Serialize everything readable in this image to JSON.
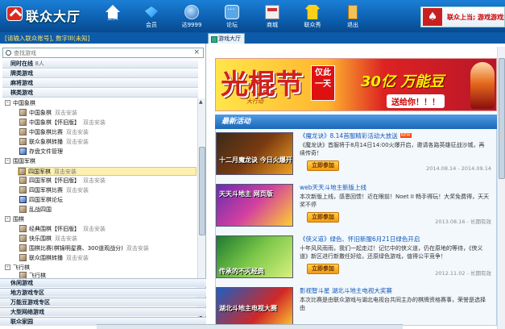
{
  "app": {
    "logo_text": "联众大厅"
  },
  "nav": [
    {
      "label": "主页",
      "icon": "home-icon"
    },
    {
      "label": "会员",
      "icon": "diamond-icon"
    },
    {
      "label": "达9999",
      "icon": "globe-icon"
    },
    {
      "label": "论坛",
      "icon": "chat-icon"
    },
    {
      "label": "商城",
      "icon": "shop-icon"
    },
    {
      "label": "联众秀",
      "icon": "shirt-icon"
    },
    {
      "label": "退出",
      "icon": "door-icon"
    }
  ],
  "notice": {
    "text": "联众上当; 游戏游戏益贼; 游"
  },
  "account": {
    "text": "[请输入联众账号], 数字III(未知]"
  },
  "tabs": {
    "hall": "游戏大厅"
  },
  "search": {
    "placeholder": "查找游戏"
  },
  "categories": {
    "online": {
      "label": "同时在线",
      "count": "8人"
    },
    "poker": "牌类游戏",
    "mahjong": "麻将游戏",
    "chess": "棋类游戏",
    "casual": "休闲游戏",
    "local": "地方游戏专区",
    "wanneng": "万能豆游戏专区",
    "network": "大型网络游戏",
    "home": "联众家园"
  },
  "tree": {
    "xiangqi": "中国象棋",
    "go": "围国军棋",
    "wuziqi": "围棋",
    "flying": "飞行棋",
    "action": "双击安装",
    "items": [
      {
        "label": "中国象棋"
      },
      {
        "label": "中国象棋【怀旧版】"
      },
      {
        "label": "中国象棋比赛"
      },
      {
        "label": "联众象棋转播"
      },
      {
        "label": "存盘文件管理"
      },
      {
        "label": "四国军棋"
      },
      {
        "label": "四国军棋【怀旧版】"
      },
      {
        "label": "四国军棋比赛"
      },
      {
        "label": "四国军棋论坛"
      },
      {
        "label": "乱战四国"
      },
      {
        "label": "经典围棋【怀旧版】"
      },
      {
        "label": "快乐围棋"
      },
      {
        "label": "围棋比赛(棋锦明星赛、300道观战分)"
      },
      {
        "label": "联众围棋转播"
      },
      {
        "label": "飞行棋"
      }
    ]
  },
  "banner": {
    "big": "光棍节",
    "small": "大行动",
    "tag": "仅此一天",
    "yi": "30亿 万能豆",
    "send": "送给你！！！"
  },
  "news": {
    "title": "最新活动",
    "button": "立即参加",
    "items": [
      {
        "title": "《魔龙诀》8.14首服精彩活动大放送",
        "desc": "《魔龙诀》首服将于8月14日14:00火爆开启，邀请各路英雄征战沙城，再续传奇！",
        "date": "2014.08.14 - 2014.09.14",
        "thumb": "十二月魔龙诀 今日火爆开服"
      },
      {
        "title": "web天天斗地主新版上线",
        "desc": "本次新版上线，感恩回馈！近在眼前！Noet II 畅手得玩！大奖免费得，天天奖不停",
        "date": "2013.08.16 - 长期有效",
        "thumb": "天天斗地主 网页版"
      },
      {
        "title": "《侠义道》绿色、怀旧新服6月21日绿色开启",
        "desc": "十年风风雨雨，我们一起走过！记忆中的侠义道，仍在原地的等待，《侠义道》新区进行新撒任好绘，还原绿色游戏，值得公平竞争！",
        "date": "2012.11.02 - 长期有效",
        "thumb": "传承的不灭经典"
      },
      {
        "title": "影视智斗星 湖北斗地主电视大奖赛",
        "desc": "本次比赛是由联众游戏与湖北电视台共同主办的棋牌资格赛事，荣誉是选择由",
        "date": "",
        "thumb": "湖北斗地主电视大赛"
      }
    ]
  }
}
